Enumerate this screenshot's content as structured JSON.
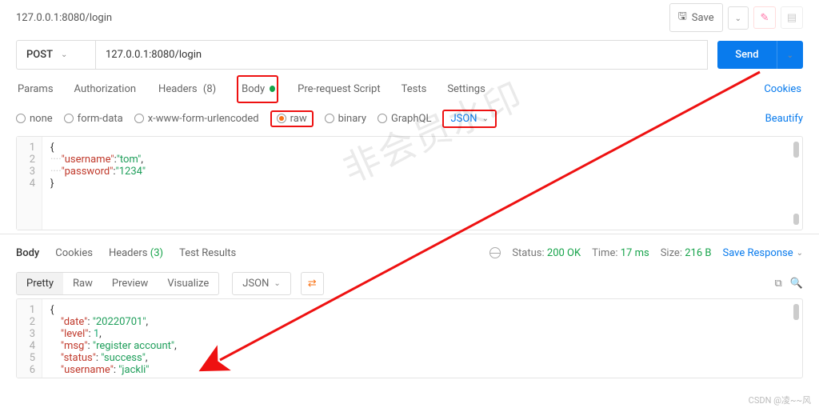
{
  "header": {
    "tab_title": "127.0.0.1:8080/login",
    "save_label": "Save"
  },
  "request": {
    "method": "POST",
    "url": "127.0.0.1:8080/login",
    "send_label": "Send"
  },
  "req_tabs": {
    "params": "Params",
    "auth": "Authorization",
    "headers": "Headers",
    "headers_count": "(8)",
    "body": "Body",
    "prereq": "Pre-request Script",
    "tests": "Tests",
    "settings": "Settings",
    "cookies": "Cookies"
  },
  "body_type": {
    "none": "none",
    "formdata": "form-data",
    "xwww": "x-www-form-urlencoded",
    "raw": "raw",
    "binary": "binary",
    "graphql": "GraphQL",
    "json": "JSON",
    "beautify": "Beautify"
  },
  "req_body_json": {
    "k1": "\"username\"",
    "v1": "\"tom\"",
    "k2": "\"password\"",
    "v2": "\"1234\""
  },
  "resp_tabs": {
    "body": "Body",
    "cookies": "Cookies",
    "headers": "Headers",
    "headers_count": "(3)",
    "test": "Test Results",
    "status_lbl": "Status:",
    "status_val": "200 OK",
    "time_lbl": "Time:",
    "time_val": "17 ms",
    "size_lbl": "Size:",
    "size_val": "216 B",
    "save": "Save Response"
  },
  "view": {
    "pretty": "Pretty",
    "raw": "Raw",
    "preview": "Preview",
    "visualize": "Visualize",
    "json": "JSON"
  },
  "resp_body_json": {
    "k1": "\"date\"",
    "v1": "\"20220701\"",
    "k2": "\"level\"",
    "v2": "1",
    "k3": "\"msg\"",
    "v3": "\"register account\"",
    "k4": "\"status\"",
    "v4": "\"success\"",
    "k5": "\"username\"",
    "v5": "\"jackli\""
  },
  "footer": {
    "csdn": "CSDN @凌~~风"
  }
}
